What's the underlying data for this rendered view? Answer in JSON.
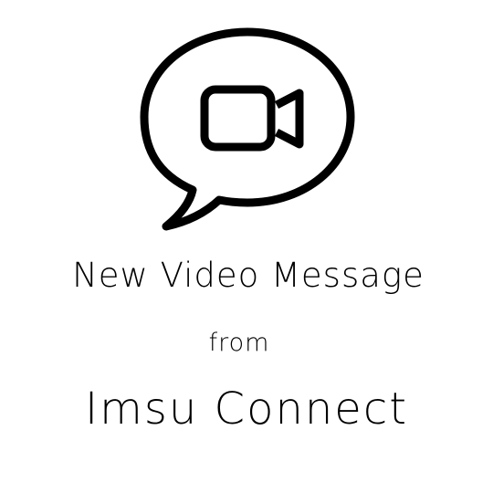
{
  "icon": "video-message-bubble-icon",
  "headline": "New Video Message",
  "from_label": "from",
  "sender": "Imsu Connect",
  "colors": {
    "foreground": "#000000",
    "background": "#ffffff"
  }
}
